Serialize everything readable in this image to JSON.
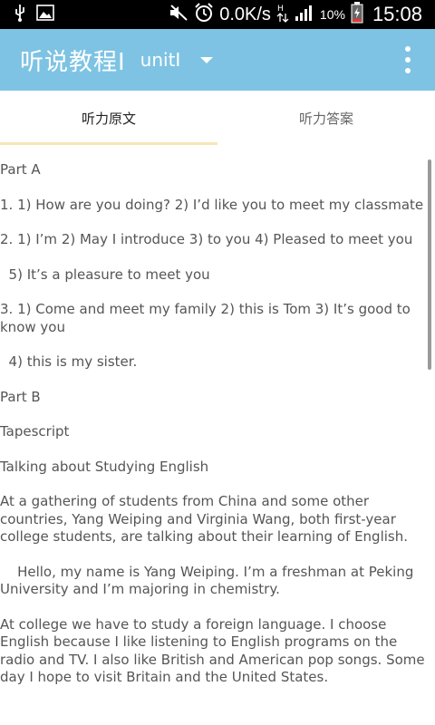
{
  "status_bar": {
    "speed": "0.0K/s",
    "battery": "10%",
    "time": "15:08",
    "icons": [
      "usb-icon",
      "image-icon",
      "mute-icon",
      "alarm-icon",
      "data-arrows-icon",
      "signal-icon",
      "battery-icon"
    ]
  },
  "app_bar": {
    "title": "听说教程Ⅰ",
    "unit": "unitⅠ",
    "color": "#7ec3e3"
  },
  "tabs": [
    {
      "label": "听力原文",
      "active": true
    },
    {
      "label": "听力答案",
      "active": false
    }
  ],
  "content": {
    "paragraphs": [
      "Part A",
      "1. 1) How are you doing?             2) I’d like you to meet my classmate",
      "2. 1) I’m        2) May I introduce 3) to you        4) Pleased to meet you",
      "  5) It’s a pleasure to meet you",
      "3. 1) Come and meet my family    2) this is Tom 3) It’s good to know you",
      "  4) this is my sister.",
      "Part B",
      "Tapescript",
      "Talking about Studying English",
      "At a gathering of students from China and some other countries, Yang Weiping and Virginia Wang, both first-year college students, are talking about their learning of English.",
      "    Hello, my name is Yang Weiping. I’m a freshman at Peking University and I’m majoring in chemistry.",
      "At college we have to study a foreign language. I choose English because I like listening to English programs on the radio and TV. I also like British and American pop songs. Some day I hope to visit Britain and the United States."
    ]
  }
}
